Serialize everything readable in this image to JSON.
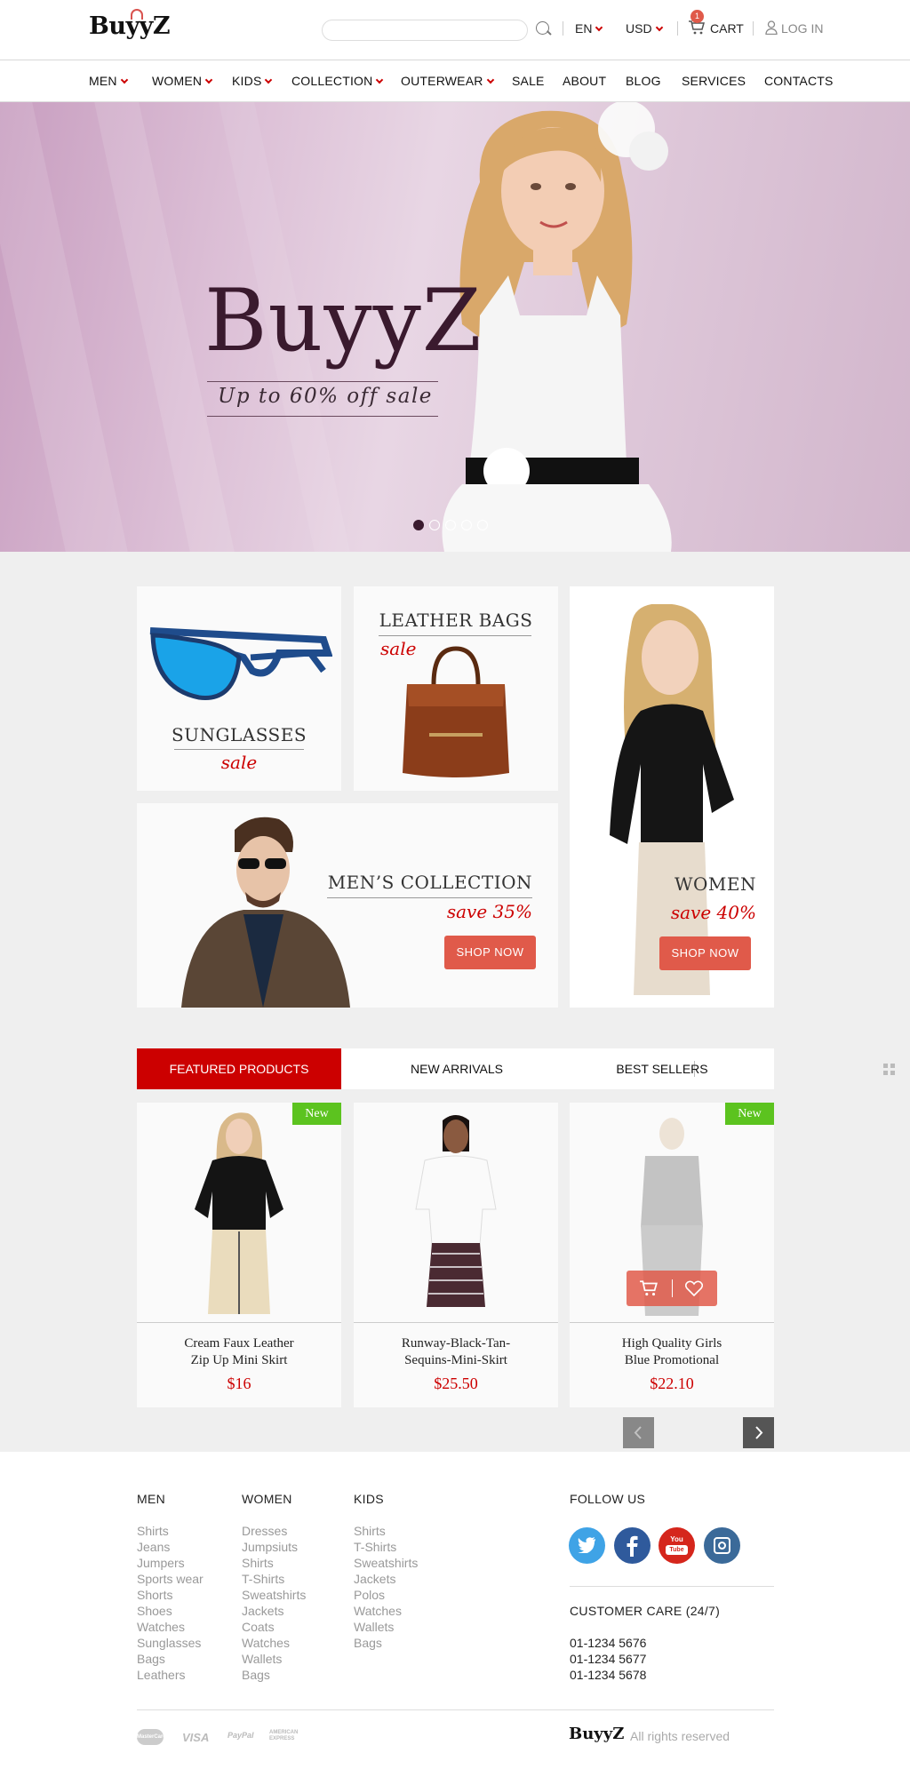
{
  "header": {
    "logo": "BuyyZ",
    "search_placeholder": "",
    "language": "EN",
    "currency": "USD",
    "cart_count": "1",
    "cart_label": "CART",
    "login_label": "LOG IN"
  },
  "nav": {
    "items": [
      {
        "label": "MEN",
        "dropdown": true
      },
      {
        "label": "WOMEN",
        "dropdown": true
      },
      {
        "label": "KIDS",
        "dropdown": true
      },
      {
        "label": "COLLECTION",
        "dropdown": true
      },
      {
        "label": "OUTERWEAR",
        "dropdown": true
      },
      {
        "label": "SALE",
        "dropdown": false
      },
      {
        "label": "ABOUT",
        "dropdown": false
      },
      {
        "label": "BLOG",
        "dropdown": false
      },
      {
        "label": "SERVICES",
        "dropdown": false
      },
      {
        "label": "CONTACTS",
        "dropdown": false
      }
    ]
  },
  "hero": {
    "title": "BuyyZ",
    "subtitle": "Up to 60% off sale",
    "slides": 5,
    "active_slide": 1
  },
  "promos": {
    "sunglasses": {
      "title": "SUNGLASSES",
      "tag": "sale"
    },
    "bags": {
      "title": "LEATHER BAGS",
      "tag": "sale"
    },
    "women": {
      "title": "WOMEN",
      "tag": "save 40%",
      "button": "SHOP NOW"
    },
    "men": {
      "title": "MEN’S COLLECTION",
      "tag": "save 35%",
      "button": "SHOP NOW"
    }
  },
  "tabs": {
    "featured": "FEATURED PRODUCTS",
    "new_arrivals": "NEW ARRIVALS",
    "best_sellers": "BEST SELLERS"
  },
  "products": [
    {
      "name_line1": "Cream Faux Leather",
      "name_line2": "Zip Up Mini Skirt",
      "price": "$16",
      "badge": "New"
    },
    {
      "name_line1": "Runway-Black-Tan-",
      "name_line2": "Sequins-Mini-Skirt",
      "price": "$25.50",
      "badge": ""
    },
    {
      "name_line1": "High Quality Girls",
      "name_line2": "Blue Promotional",
      "price": "$22.10",
      "badge": "New"
    }
  ],
  "footer": {
    "men": {
      "title": "MEN",
      "items": [
        "Shirts",
        "Jeans",
        "Jumpers",
        "Sports wear",
        "Shorts",
        "Shoes",
        "Watches",
        "Sunglasses",
        "Bags",
        "Leathers"
      ]
    },
    "women": {
      "title": "WOMEN",
      "items": [
        "Dresses",
        "Jumpsiuts",
        "Shirts",
        "T-Shirts",
        "Sweatshirts",
        "Jackets",
        "Coats",
        "Watches",
        "Wallets",
        "Bags"
      ]
    },
    "kids": {
      "title": "KIDS",
      "items": [
        "Shirts",
        "T-Shirts",
        "Sweatshirts",
        "Jackets",
        "Polos",
        "Watches",
        "Wallets",
        "Bags"
      ]
    },
    "follow_title": "FOLLOW US",
    "care_title": "CUSTOMER CARE (24/7)",
    "phones": [
      "01-1234 5676",
      "01-1234 5677",
      "01-1234 5678"
    ],
    "payments": [
      "MasterCard",
      "VISA",
      "PayPal",
      "AMERICAN EXPRESS"
    ],
    "logo": "BuyyZ",
    "copyright": "All rights reserved"
  },
  "colors": {
    "accent": "#cc0000",
    "button": "#e05a4a",
    "new_badge": "#5cc31f",
    "twitter": "#3fa3e6",
    "facebook": "#2f5a9c",
    "youtube": "#d5261c",
    "instagram": "#3b6a99"
  }
}
